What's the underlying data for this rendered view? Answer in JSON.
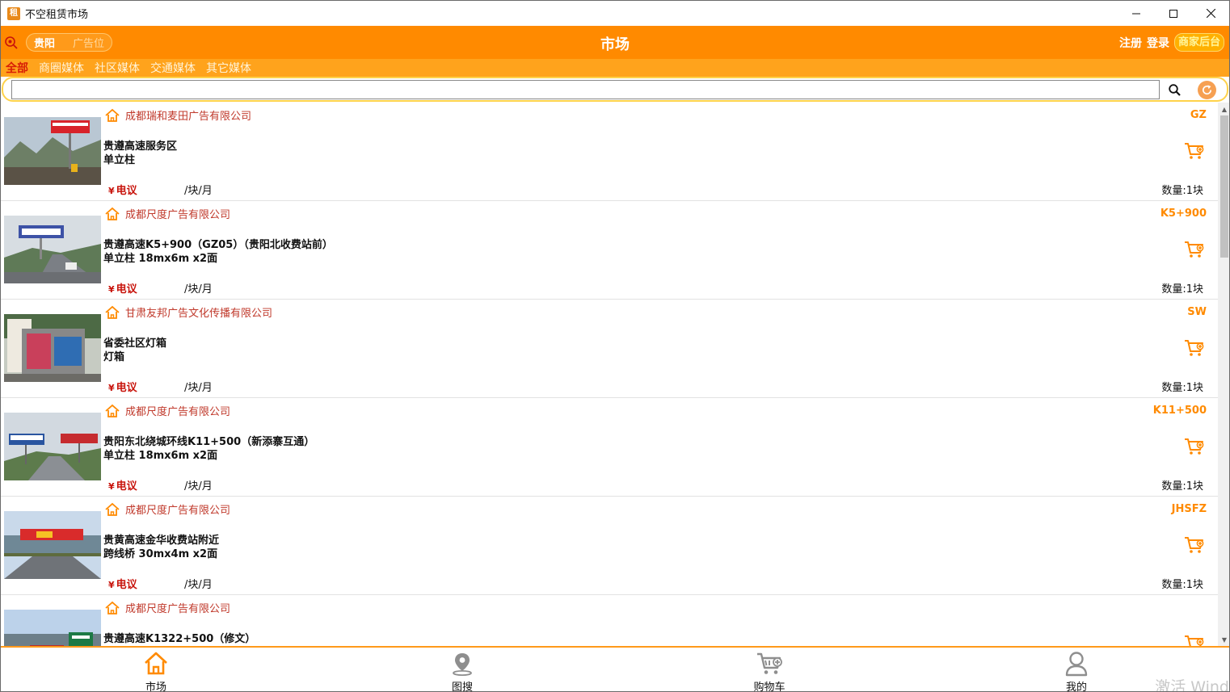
{
  "window": {
    "title": "不空租赁市场",
    "app_icon_text": "租"
  },
  "header": {
    "city": "贵阳",
    "type": "广告位",
    "title": "市场",
    "register": "注册",
    "login": "登录",
    "merchant": "商家后台"
  },
  "categories": [
    {
      "label": "全部",
      "active": true
    },
    {
      "label": "商圈媒体"
    },
    {
      "label": "社区媒体"
    },
    {
      "label": "交通媒体"
    },
    {
      "label": "其它媒体"
    }
  ],
  "search": {
    "value": "",
    "placeholder": ""
  },
  "listings": [
    {
      "company": "成都瑞和麦田广告有限公司",
      "code": "GZ",
      "name": "贵遵高速服务区",
      "spec": "单立柱",
      "price": "电议",
      "unit": "/块/月",
      "qty": "数量:1块"
    },
    {
      "company": "成都尺度广告有限公司",
      "code": "K5+900",
      "name": "贵遵高速K5+900（GZ05）（贵阳北收费站前）",
      "spec": "单立柱 18mx6m x2面",
      "price": "电议",
      "unit": "/块/月",
      "qty": "数量:1块"
    },
    {
      "company": "甘肃友邦广告文化传播有限公司",
      "code": "SW",
      "name": "省委社区灯箱",
      "spec": "灯箱",
      "price": "电议",
      "unit": "/块/月",
      "qty": "数量:1块"
    },
    {
      "company": "成都尺度广告有限公司",
      "code": "K11+500",
      "name": "贵阳东北绕城环线K11+500（新添寨互通）",
      "spec": "单立柱 18mx6m x2面",
      "price": "电议",
      "unit": "/块/月",
      "qty": "数量:1块"
    },
    {
      "company": "成都尺度广告有限公司",
      "code": "JHSFZ",
      "name": "贵黄高速金华收费站附近",
      "spec": "跨线桥 30mx4m x2面",
      "price": "电议",
      "unit": "/块/月",
      "qty": "数量:1块"
    },
    {
      "company": "成都尺度广告有限公司",
      "code": "",
      "name": "贵遵高速K1322+500（修文）",
      "spec": "",
      "price": "",
      "unit": "",
      "qty": ""
    }
  ],
  "currency_symbol": "¥",
  "nav": [
    {
      "label": "市场",
      "icon": "home-icon",
      "active": true
    },
    {
      "label": "图搜",
      "icon": "map-pin-icon"
    },
    {
      "label": "购物车",
      "icon": "cart-icon"
    },
    {
      "label": "我的",
      "icon": "user-icon"
    }
  ],
  "watermark": "激活 Wind",
  "colors": {
    "accent": "#ff8a00",
    "price": "#c8140c",
    "company": "#c0392b"
  }
}
